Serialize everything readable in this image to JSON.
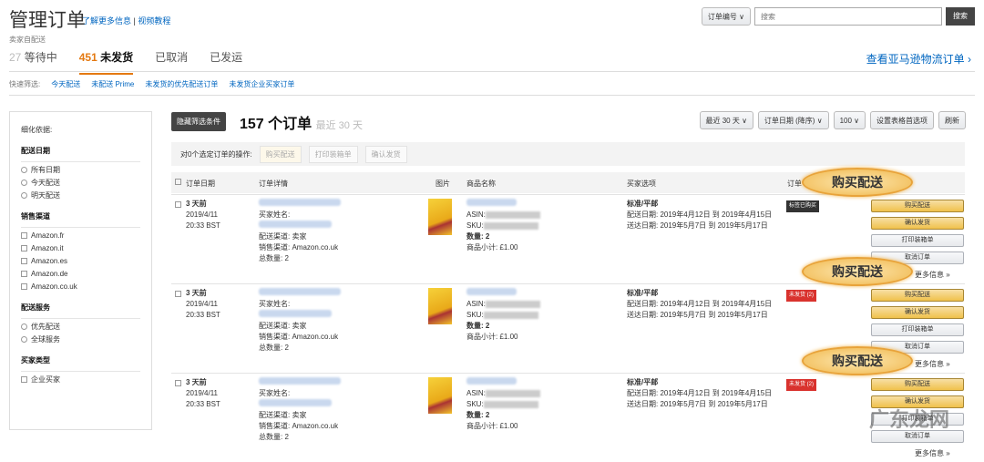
{
  "header": {
    "title": "管理订单",
    "learn_more": "了解更多信息",
    "video": "视频教程",
    "subtitle": "卖家自配送",
    "amazon_link": "查看亚马逊物流订单 ›"
  },
  "search": {
    "field": "订单编号 ∨",
    "placeholder": "搜索",
    "button": "搜索"
  },
  "tabs": [
    {
      "count": "27",
      "label": "等待中"
    },
    {
      "count": "451",
      "label": "未发货"
    },
    {
      "label": "已取消"
    },
    {
      "label": "已发运"
    }
  ],
  "quick": {
    "label": "快速筛选:",
    "items": [
      "今天配送",
      "未配送 Prime",
      "未发货的优先配送订单",
      "未发货企业买家订单"
    ]
  },
  "sidebar": {
    "title": "细化依据:",
    "groups": [
      {
        "title": "配送日期",
        "type": "radio",
        "items": [
          "所有日期",
          "今天配送",
          "明天配送"
        ]
      },
      {
        "title": "销售渠道",
        "type": "check",
        "items": [
          "Amazon.fr",
          "Amazon.it",
          "Amazon.es",
          "Amazon.de",
          "Amazon.co.uk"
        ]
      },
      {
        "title": "配送服务",
        "type": "radio",
        "items": [
          "优先配送",
          "全球服务"
        ]
      },
      {
        "title": "买家类型",
        "type": "check",
        "items": [
          "企业买家"
        ]
      }
    ]
  },
  "toolbar": {
    "hide_filters": "隐藏筛选条件",
    "count": "157 个订单",
    "range": "最近 30 天",
    "period": "最近 30 天 ∨",
    "sort": "订单日期 (降序) ∨",
    "per_page": "100 ∨",
    "prefs": "设置表格首选项",
    "refresh": "刷新"
  },
  "bulk": {
    "label": "对0个选定订单的操作:",
    "buy": "购买配送",
    "print": "打印装箱单",
    "confirm": "确认发货"
  },
  "columns": [
    "订单日期",
    "订单详情",
    "图片",
    "商品名称",
    "买家选项",
    "订单"
  ],
  "rows": [
    {
      "age": "3 天前",
      "date": "2019/4/11",
      "time": "20:33 BST",
      "buyer": "买家姓名:",
      "channel_by": "配送渠道: 卖家",
      "channel": "销售渠道: Amazon.co.uk",
      "total": "总数量: 2",
      "asin": "ASIN:",
      "sku": "SKU:",
      "qty": "数量: 2",
      "subtotal": "商品小计: £1.00",
      "ship": "标准/平邮",
      "ship_date": "配送日期: 2019年4月12日 到 2019年4月15日",
      "deliver": "送达日期: 2019年5月7日 到 2019年5月17日",
      "badge": "标签已购买",
      "badge_color": "#333333"
    },
    {
      "age": "3 天前",
      "date": "2019/4/11",
      "time": "20:33 BST",
      "buyer": "买家姓名:",
      "channel_by": "配送渠道: 卖家",
      "channel": "销售渠道: Amazon.co.uk",
      "total": "总数量: 2",
      "asin": "ASIN:",
      "sku": "SKU:",
      "qty": "数量: 2",
      "subtotal": "商品小计: £1.00",
      "ship": "标准/平邮",
      "ship_date": "配送日期: 2019年4月12日 到 2019年4月15日",
      "deliver": "送达日期: 2019年5月7日 到 2019年5月17日",
      "badge": "未发货 (2)",
      "badge_color": "#d9322e"
    },
    {
      "age": "3 天前",
      "date": "2019/4/11",
      "time": "20:33 BST",
      "buyer": "买家姓名:",
      "channel_by": "配送渠道: 卖家",
      "channel": "销售渠道: Amazon.co.uk",
      "total": "总数量: 2",
      "asin": "ASIN:",
      "sku": "SKU:",
      "qty": "数量: 2",
      "subtotal": "商品小计: £1.00",
      "ship": "标准/平邮",
      "ship_date": "配送日期: 2019年4月12日 到 2019年4月15日",
      "deliver": "送达日期: 2019年5月7日 到 2019年5月17日",
      "badge": "未发货 (2)",
      "badge_color": "#d9322e"
    }
  ],
  "row_actions": {
    "buy": "购买配送",
    "confirm": "确认发货",
    "print": "打印装箱单",
    "cancel": "取消订单",
    "more": "更多信息 »"
  },
  "callout": "购买配送",
  "watermark": "广东龙网"
}
